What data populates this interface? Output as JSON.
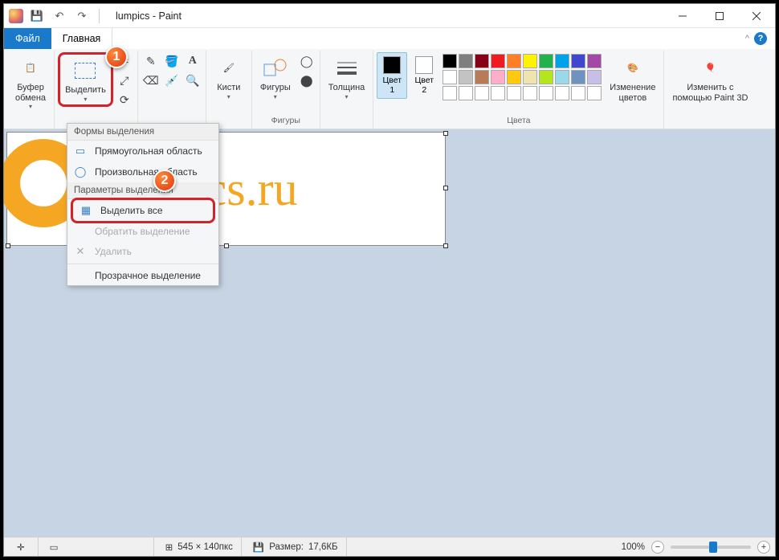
{
  "title": "lumpics - Paint",
  "tabs": {
    "file": "Файл",
    "home": "Главная"
  },
  "groups": {
    "clipboard": {
      "label": "Буфер обмена",
      "btn": "Буфер\nобмена"
    },
    "image": {
      "select": "Выделить"
    },
    "tools": {
      "brushes": "Кисти"
    },
    "shapes": {
      "label": "Фигуры",
      "btn": "Фигуры"
    },
    "thickness": "Толщина",
    "colors": {
      "label": "Цвета",
      "c1": "Цвет\n1",
      "c2": "Цвет\n2",
      "edit": "Изменение\nцветов"
    },
    "paint3d": "Изменить с\nпомощью Paint 3D"
  },
  "dropdown": {
    "section1": "Формы выделения",
    "rect": "Прямоугольная область",
    "free": "Произвольная область",
    "section2": "Параметры выделения",
    "all": "Выделить все",
    "invert": "Обратить выделение",
    "delete": "Удалить",
    "transparent": "Прозрачное выделение"
  },
  "canvas_text": "npics.ru",
  "status": {
    "dims": "545 × 140пкс",
    "size_label": "Размер:",
    "size_val": "17,6КБ",
    "zoom": "100%"
  },
  "palette_row1": [
    "#000000",
    "#7f7f7f",
    "#880015",
    "#ed1c24",
    "#ff7f27",
    "#fff200",
    "#22b14c",
    "#00a2e8",
    "#3f48cc",
    "#a349a4"
  ],
  "palette_row2": [
    "#ffffff",
    "#c3c3c3",
    "#b97a57",
    "#ffaec9",
    "#ffc90e",
    "#efe4b0",
    "#b5e61d",
    "#99d9ea",
    "#7092be",
    "#c8bfe7"
  ],
  "palette_row3": [
    "#ffffff",
    "#ffffff",
    "#ffffff",
    "#ffffff",
    "#ffffff",
    "#ffffff",
    "#ffffff",
    "#ffffff",
    "#ffffff",
    "#ffffff"
  ],
  "markers": {
    "m1": "1",
    "m2": "2"
  }
}
